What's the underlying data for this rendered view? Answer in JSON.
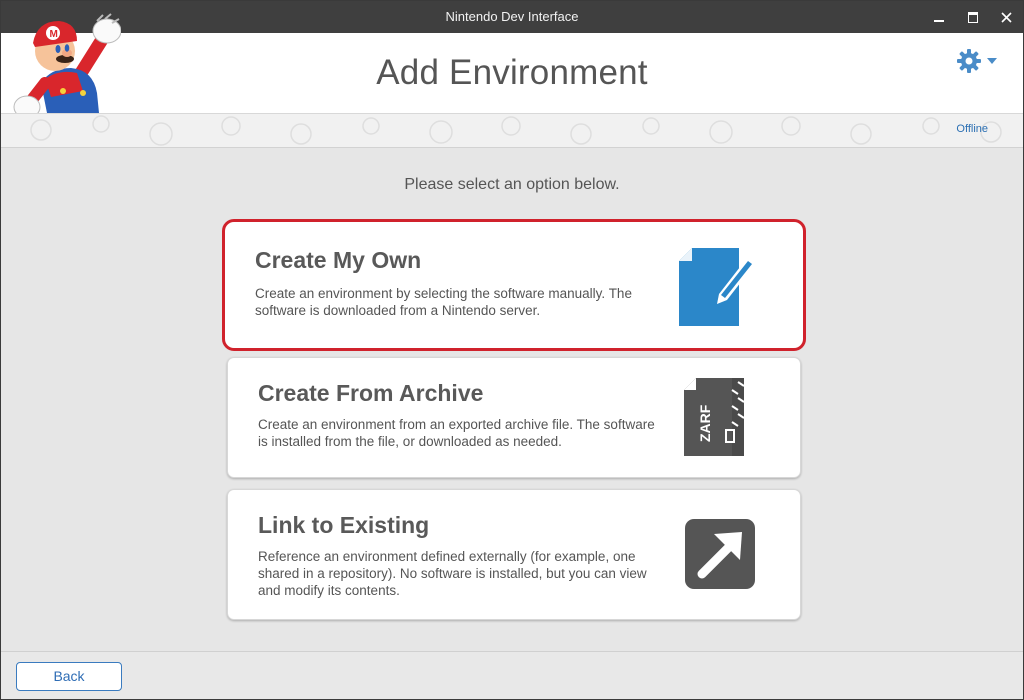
{
  "window": {
    "title": "Nintendo Dev Interface"
  },
  "header": {
    "title": "Add Environment",
    "status": "Offline"
  },
  "main": {
    "subtitle": "Please select an option below.",
    "options": [
      {
        "title": "Create My Own",
        "description": "Create an environment by selecting the software manually. The software is downloaded from a Nintendo server.",
        "icon": "edit-document-icon",
        "selected": true
      },
      {
        "title": "Create From Archive",
        "description": "Create an environment from an exported archive file. The software is installed from the file, or downloaded as needed.",
        "icon": "zip-archive-icon",
        "icon_text": "ZARF",
        "selected": false
      },
      {
        "title": "Link to Existing",
        "description": "Reference an environment defined externally (for example, one shared in a repository). No software is installed, but you can view and modify its contents.",
        "icon": "external-link-icon",
        "selected": false
      }
    ]
  },
  "footer": {
    "back_label": "Back"
  },
  "colors": {
    "accent_blue": "#2b87c9",
    "selected_border": "#d0222c",
    "mario_red": "#e0282e"
  }
}
